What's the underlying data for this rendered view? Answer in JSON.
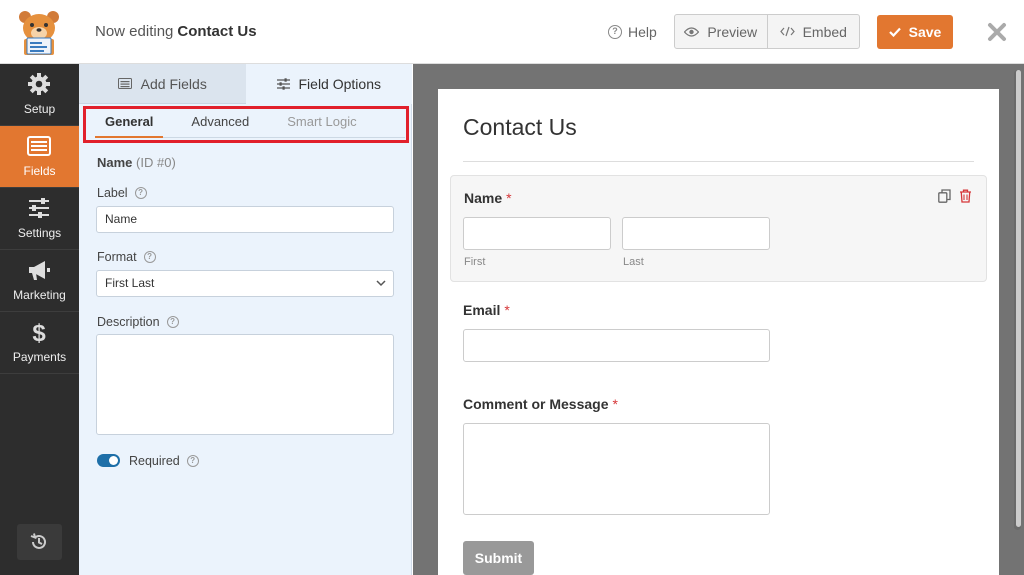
{
  "header": {
    "editing_prefix": "Now editing",
    "form_name": "Contact Us",
    "help_label": "Help",
    "preview_label": "Preview",
    "embed_label": "Embed",
    "save_label": "Save"
  },
  "sidebar": {
    "items": [
      {
        "label": "Setup",
        "icon": "gear-icon"
      },
      {
        "label": "Fields",
        "icon": "fields-list-icon",
        "active": true
      },
      {
        "label": "Settings",
        "icon": "sliders-icon"
      },
      {
        "label": "Marketing",
        "icon": "megaphone-icon"
      },
      {
        "label": "Payments",
        "icon": "dollar-icon"
      }
    ]
  },
  "panel": {
    "tabs": [
      {
        "label": "Add Fields",
        "icon": "list-icon"
      },
      {
        "label": "Field Options",
        "icon": "sliders-icon",
        "active": true
      }
    ],
    "subtabs": [
      {
        "label": "General",
        "active": true
      },
      {
        "label": "Advanced"
      },
      {
        "label": "Smart Logic",
        "disabled": true
      }
    ],
    "field_name": "Name",
    "field_id": "(ID #0)",
    "label_title": "Label",
    "label_value": "Name",
    "format_title": "Format",
    "format_value": "First Last",
    "description_title": "Description",
    "required_label": "Required",
    "required_on": true
  },
  "preview": {
    "form_title": "Contact Us",
    "name_label": "Name",
    "first_sublabel": "First",
    "last_sublabel": "Last",
    "email_label": "Email",
    "message_label": "Comment or Message",
    "required_marker": "*",
    "submit_label": "Submit"
  },
  "colors": {
    "accent": "#e27730",
    "sidebar_bg": "#2d2d2d",
    "panel_bg": "#ebf3fc",
    "highlight_box": "#e1202b",
    "toggle_on": "#1e6fa8",
    "required_star": "#d63638"
  }
}
